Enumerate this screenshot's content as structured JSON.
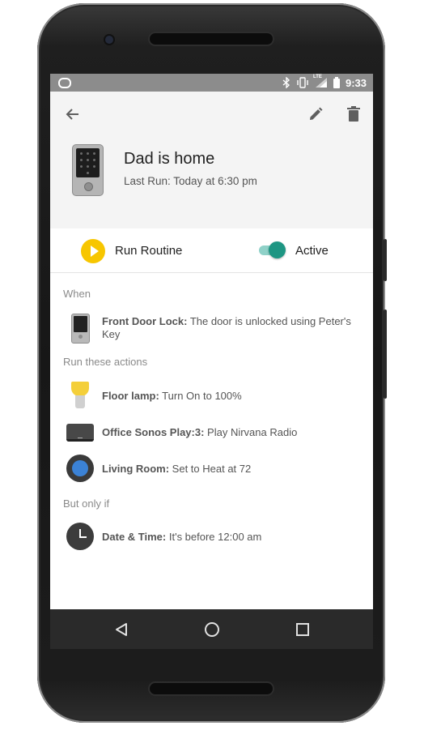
{
  "status_bar": {
    "time": "9:33",
    "network": "LTE"
  },
  "header": {
    "back_icon": "arrow-back-icon",
    "edit_icon": "pencil-icon",
    "delete_icon": "trash-icon",
    "title": "Dad is home",
    "subtitle": "Last Run: Today at 6:30 pm"
  },
  "controls": {
    "run_label": "Run Routine",
    "active_label": "Active",
    "active_on": true
  },
  "sections": {
    "when": "When",
    "actions": "Run these actions",
    "conditions": "But only if"
  },
  "when_items": [
    {
      "device": "Front Door Lock:",
      "description": "The door is unlocked using Peter's Key"
    }
  ],
  "actions": [
    {
      "device": "Floor lamp:",
      "description": "Turn On to 100%"
    },
    {
      "device": "Office Sonos Play:3:",
      "description": "Play Nirvana Radio"
    },
    {
      "device": "Living Room:",
      "description": "Set to Heat at 72"
    }
  ],
  "conditions": [
    {
      "device": "Date & Time:",
      "description": "It's before 12:00 am"
    }
  ],
  "colors": {
    "accent_yellow": "#f7c600",
    "toggle_teal": "#1e9683",
    "status_bar": "#8c8c8c",
    "nav_bar": "#2a2a2a"
  }
}
